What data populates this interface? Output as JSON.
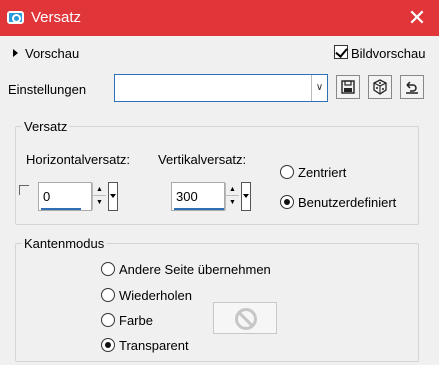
{
  "window": {
    "title": "Versatz",
    "close_glyph": "✕"
  },
  "preview": {
    "label": "Vorschau",
    "bild_label": "Bildvorschau",
    "bild_checked": true
  },
  "settings": {
    "label": "Einstellungen",
    "value": ""
  },
  "toolbar": {
    "save_icon": "save-icon",
    "dice_icon": "dice-icon",
    "reset_icon": "reset-icon"
  },
  "offset": {
    "group_label": "Versatz",
    "horizontal_label": "Horizontalversatz:",
    "horizontal_value": "0",
    "vertical_label": "Vertikalversatz:",
    "vertical_value": "300",
    "centered_label": "Zentriert",
    "custom_label": "Benutzerdefiniert",
    "selected": "custom"
  },
  "edge": {
    "group_label": "Kantenmodus",
    "options": [
      {
        "label": "Andere Seite übernehmen",
        "checked": false
      },
      {
        "label": "Wiederholen",
        "checked": false
      },
      {
        "label": "Farbe",
        "checked": false
      },
      {
        "label": "Transparent",
        "checked": true
      }
    ]
  },
  "colors": {
    "titlebar": "#e0363a",
    "accent": "#2f6fb5"
  }
}
